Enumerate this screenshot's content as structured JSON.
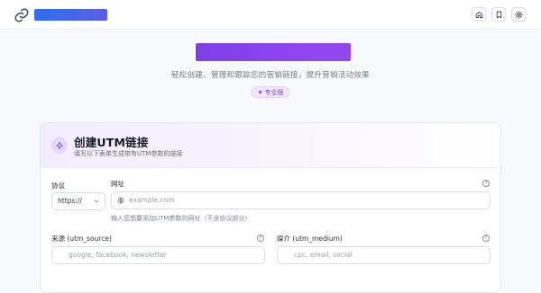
{
  "header": {
    "icons": [
      "link-icon",
      "home-icon",
      "bookmark-icon",
      "sun-icon"
    ],
    "accent_blue": "#2f6cf0"
  },
  "hero": {
    "subtitle": "轻松创建、管理和跟踪您的营销链接，提升营销活动效果",
    "badge": "专业版",
    "accent_purple": "#8b44f2"
  },
  "card": {
    "title": "创建UTM链接",
    "description": "填写以下表单生成带有UTM参数的链接",
    "protocol": {
      "label": "协议",
      "value": "https://"
    },
    "url": {
      "label": "网址",
      "placeholder": "example.com",
      "hint": "输入您想要添加UTM参数的网址（不含协议部分）"
    },
    "source": {
      "label": "来源 (utm_source)",
      "placeholder": "google, facebook, newsletter"
    },
    "medium": {
      "label": "媒介 (utm_medium)",
      "placeholder": "cpc, email, social"
    }
  }
}
